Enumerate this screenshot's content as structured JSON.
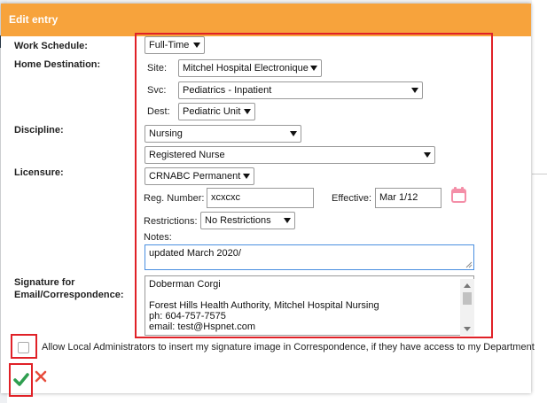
{
  "dialog": {
    "title": "Edit entry",
    "labels": {
      "work_schedule": "Work Schedule:",
      "home_destination": "Home Destination:",
      "discipline": "Discipline:",
      "licensure": "Licensure:",
      "signature_line1": "Signature for",
      "signature_line2": "Email/Correspondence:"
    },
    "work_schedule": {
      "selected": "Full-Time"
    },
    "home_destination": {
      "site_label": "Site:",
      "site": "Mitchel Hospital Electronique",
      "svc_label": "Svc:",
      "svc": "Pediatrics - Inpatient",
      "dest_label": "Dest:",
      "dest": "Pediatric Unit"
    },
    "discipline": {
      "selected": "Nursing",
      "role": "Registered Nurse"
    },
    "licensure": {
      "selected": "CRNABC Permanent",
      "reg_number_label": "Reg. Number:",
      "reg_number": "xcxcxc",
      "effective_label": "Effective:",
      "effective": "Mar 1/12",
      "restrictions_label": "Restrictions:",
      "restrictions": "No Restrictions",
      "notes_label": "Notes:",
      "notes": "updated March 2020/"
    },
    "signature": {
      "line1": "Doberman Corgi",
      "line2": "Forest Hills Health Authority, Mitchel Hospital Nursing",
      "line3": "ph: 604-757-7575",
      "line4": "email: test@Hspnet.com"
    },
    "allow_signature_label": "Allow Local Administrators to insert my signature image in Correspondence, if they have access to my Department",
    "colors": {
      "header": "#f7a33c",
      "highlight": "#e02127",
      "save": "#2e9e4f",
      "cancel": "#e74c3c"
    },
    "icons": [
      "calendar-icon",
      "checkmark-icon",
      "close-icon"
    ]
  }
}
